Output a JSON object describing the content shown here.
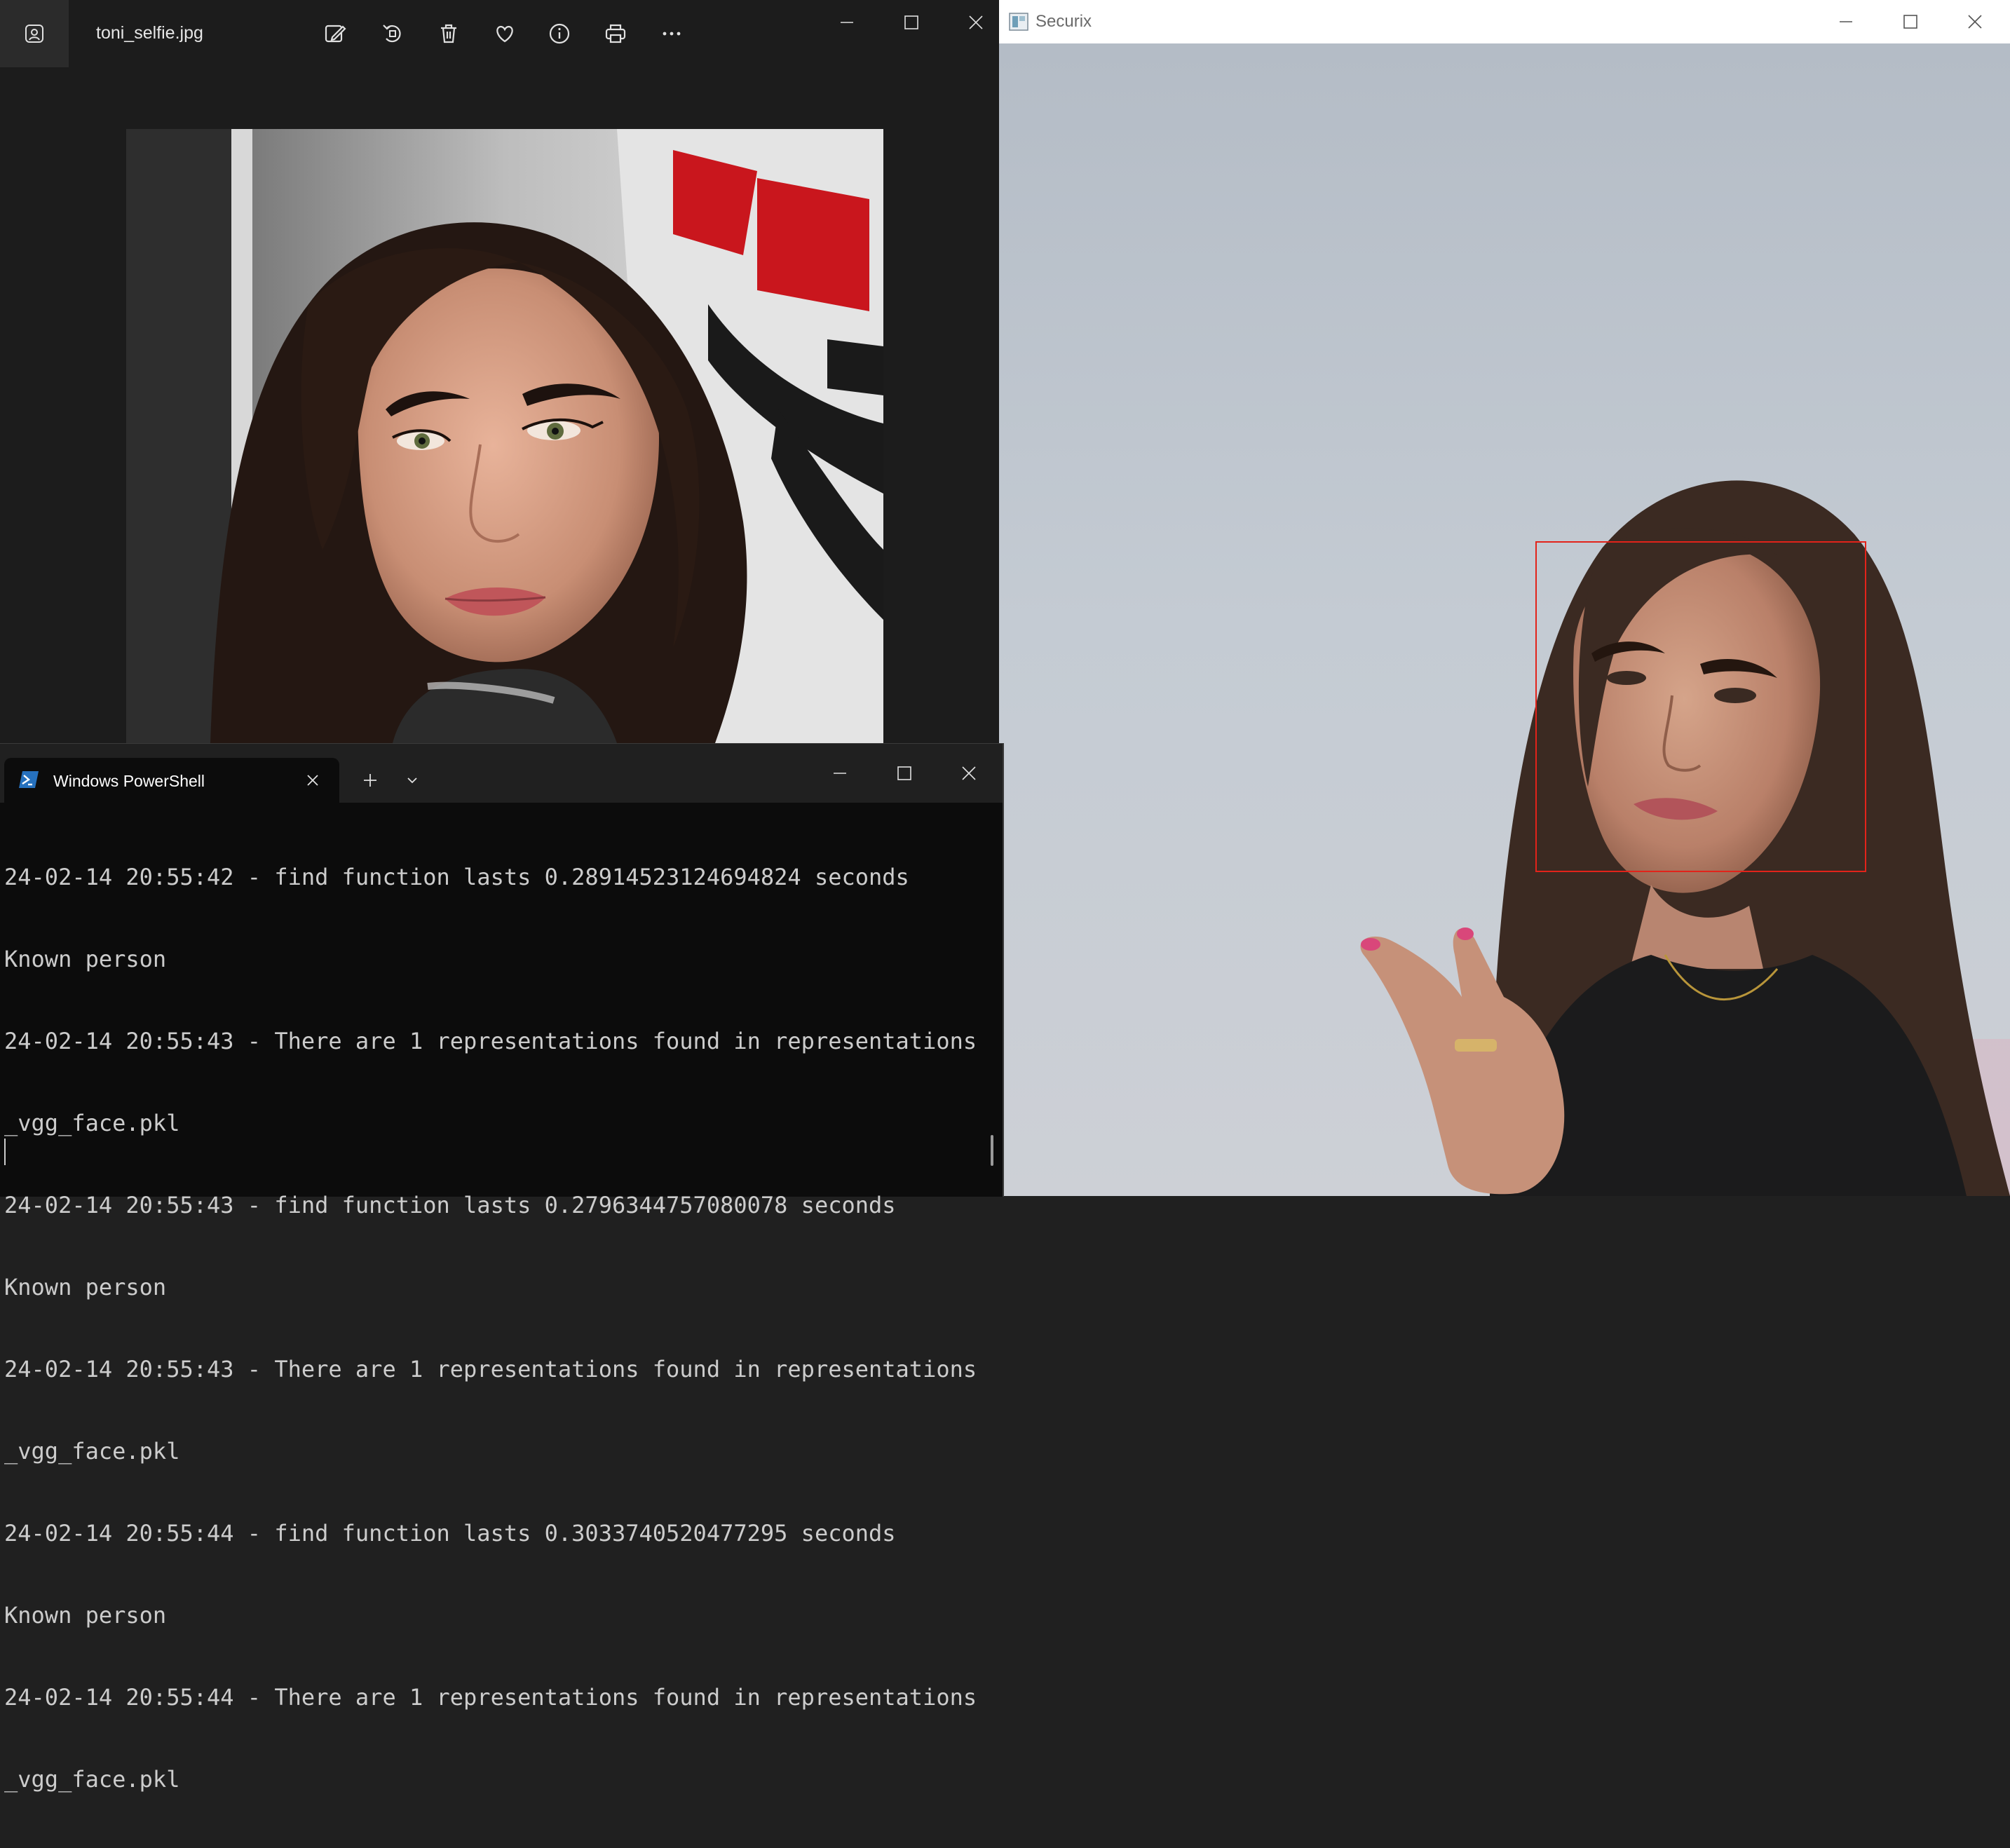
{
  "photos": {
    "filename": "toni_selfie.jpg",
    "toolbar": [
      "edit-icon",
      "rotate-icon",
      "trash-icon",
      "heart-icon",
      "info-icon",
      "print-icon",
      "more-icon"
    ]
  },
  "securix": {
    "title": "Securix"
  },
  "powershell": {
    "tab_label": "Windows PowerShell",
    "lines": [
      "24-02-14 20:55:42 - find function lasts 0.28914523124694824 seconds",
      "Known person",
      "24-02-14 20:55:43 - There are 1 representations found in representations",
      "_vgg_face.pkl",
      "24-02-14 20:55:43 - find function lasts 0.2796344757080078 seconds",
      "Known person",
      "24-02-14 20:55:43 - There are 1 representations found in representations",
      "_vgg_face.pkl",
      "24-02-14 20:55:44 - find function lasts 0.3033740520477295 seconds",
      "Known person",
      "24-02-14 20:55:44 - There are 1 representations found in representations",
      "_vgg_face.pkl"
    ]
  },
  "colors": {
    "face_box": "#e2231a",
    "terminal_bg": "#0c0c0c",
    "terminal_text": "#cccccc"
  }
}
